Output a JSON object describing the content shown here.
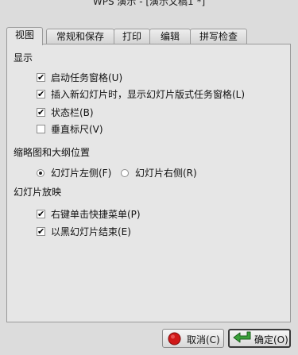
{
  "window": {
    "title": "WPS 演示 - [演示文稿1 *]"
  },
  "tabs": [
    {
      "label": "视图",
      "active": true
    },
    {
      "label": "常规和保存",
      "active": false
    },
    {
      "label": "打印",
      "active": false
    },
    {
      "label": "编辑",
      "active": false
    },
    {
      "label": "拼写检查",
      "active": false
    }
  ],
  "display": {
    "heading": "显示",
    "options": [
      {
        "label": "启动任务窗格(U)",
        "checked": true
      },
      {
        "label": "插入新幻灯片时，显示幻灯片版式任务窗格(L)",
        "checked": true
      },
      {
        "label": "状态栏(B)",
        "checked": true
      },
      {
        "label": "垂直标尺(V)",
        "checked": false
      }
    ]
  },
  "thumbnail": {
    "heading": "缩略图和大纲位置",
    "options": [
      {
        "label": "幻灯片左侧(F)",
        "selected": true
      },
      {
        "label": "幻灯片右侧(R)",
        "selected": false
      }
    ]
  },
  "slideshow": {
    "heading": "幻灯片放映",
    "options": [
      {
        "label": "右键单击快捷菜单(P)",
        "checked": true
      },
      {
        "label": "以黑幻灯片结束(E)",
        "checked": true
      }
    ]
  },
  "buttons": {
    "cancel_label": "取消(C)",
    "ok_label": "确定(O)"
  },
  "icons": {
    "cancel": "red-circle-icon",
    "ok": "green-arrow-icon"
  }
}
